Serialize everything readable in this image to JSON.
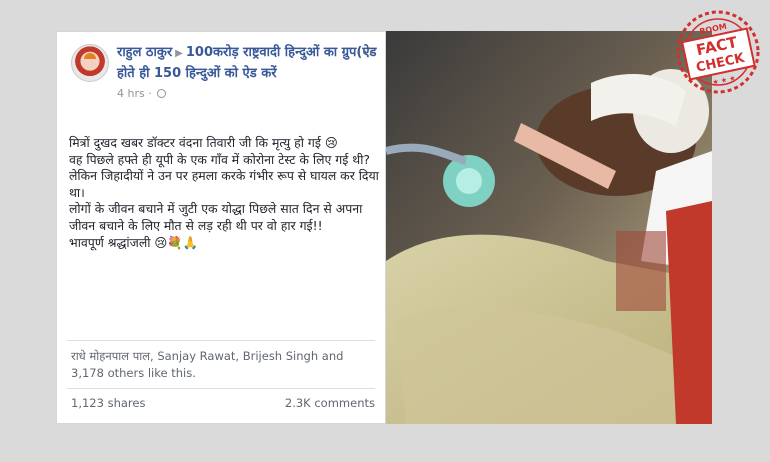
{
  "post": {
    "author": "राहुल ठाकुर",
    "group": "100करोड़ राष्ट्रवादी हिन्दुओं का ग्रुप(ऐड होते ही 150 हिन्दुओं को ऐड करें",
    "time": "4 hrs",
    "more_icon": "more-dots-icon",
    "privacy_icon": "globe-icon",
    "body_lines": [
      "मित्रों दुखद खबर डॉक्टर वंदना तिवारी जी कि मृत्यु हो गई 😢",
      "वह पिछले हफ्ते ही यूपी के एक गाँव में कोरोना टेस्ट के लिए गई थी?",
      "लेकिन जिहादीयों ने उन पर हमला करके गंभीर रूप से घायल कर दिया था।",
      "लोगों के जीवन बचाने में जुटी एक योद्धा पिछले सात दिन से अपना जीवन बचाने के लिए मौत से लड़ रही थी पर वो हार गई!!",
      "भावपूर्ण श्रद्धांजली 😢💐🙏"
    ],
    "likes_text": "राधे मोहनपाल पाल, Sanjay Rawat, Brijesh Singh and 3,178 others like this.",
    "shares": "1,123 shares",
    "comments": "2.3K comments"
  },
  "badge": {
    "top_text": "BOOM",
    "line1": "FACT",
    "line2": "CHECK",
    "color": "#d32f2f"
  }
}
